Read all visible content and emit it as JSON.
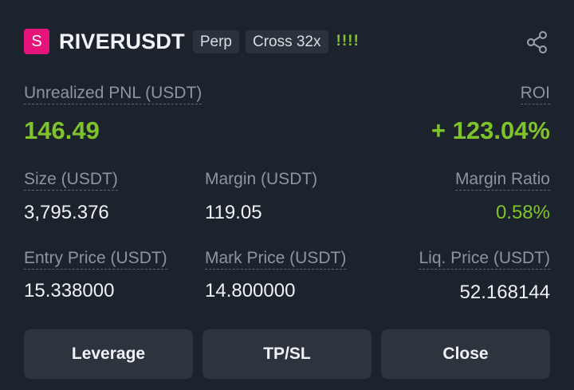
{
  "header": {
    "symbol_badge": "S",
    "symbol": "RIVERUSDT",
    "tags": [
      "Perp",
      "Cross 32x"
    ],
    "signal": "!!!!",
    "share_icon": "share-icon"
  },
  "pnl": {
    "label": "Unrealized PNL (USDT)",
    "value": "146.49",
    "roi_label": "ROI",
    "roi_value": "+ 123.04%"
  },
  "stats": {
    "size_label": "Size (USDT)",
    "size_value": "3,795.376",
    "margin_label": "Margin (USDT)",
    "margin_value": "119.05",
    "margin_ratio_label": "Margin Ratio",
    "margin_ratio_value": "0.58%",
    "entry_label": "Entry Price (USDT)",
    "entry_value": "15.338000",
    "mark_label": "Mark Price (USDT)",
    "mark_value": "14.800000",
    "liq_label": "Liq. Price (USDT)",
    "liq_value": "52.168144"
  },
  "actions": {
    "leverage": "Leverage",
    "tpsl": "TP/SL",
    "close": "Close"
  },
  "colors": {
    "background": "#1d232c",
    "positive": "#7fc32b",
    "badge": "#e6137a"
  }
}
